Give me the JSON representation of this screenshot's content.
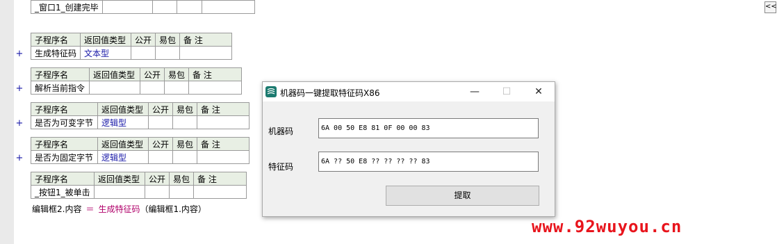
{
  "editor": {
    "event_table": {
      "row": [
        "_窗口1_创建完毕",
        "",
        "",
        "",
        ""
      ]
    },
    "sub_tables": [
      {
        "header": [
          "子程序名",
          "返回值类型",
          "公开",
          "易包",
          "备 注"
        ],
        "row": [
          "生成特征码",
          "文本型",
          "",
          "",
          ""
        ]
      },
      {
        "header": [
          "子程序名",
          "返回值类型",
          "公开",
          "易包",
          "备 注"
        ],
        "row": [
          "解析当前指令",
          "",
          "",
          "",
          ""
        ]
      },
      {
        "header": [
          "子程序名",
          "返回值类型",
          "公开",
          "易包",
          "备 注"
        ],
        "row": [
          "是否为可变字节",
          "逻辑型",
          "",
          "",
          ""
        ]
      },
      {
        "header": [
          "子程序名",
          "返回值类型",
          "公开",
          "易包",
          "备 注"
        ],
        "row": [
          "是否为固定字节",
          "逻辑型",
          "",
          "",
          ""
        ]
      },
      {
        "header": [
          "子程序名",
          "返回值类型",
          "公开",
          "易包",
          "备 注"
        ],
        "row": [
          "_按钮1_被单击",
          "",
          "",
          "",
          ""
        ]
      }
    ],
    "plus_sign": "+",
    "code_line": {
      "lhs": "编辑框2.内容",
      "eq": "＝",
      "fn": "生成特征码",
      "args": "（编辑框1.内容）"
    },
    "collapse_label": "<<"
  },
  "dialog": {
    "title": "机器码一键提取特征码X86",
    "machine_code_label": "机器码",
    "machine_code_value": "6A 00 50 E8 81 0F 00 00 83",
    "signature_label": "特征码",
    "signature_value": "6A ?? 50 E8 ?? ?? ?? ?? 83",
    "extract_button": "提取",
    "min_glyph": "—",
    "max_glyph": "☐",
    "close_glyph": "✕"
  },
  "watermark": "www.92wuyou.cn"
}
